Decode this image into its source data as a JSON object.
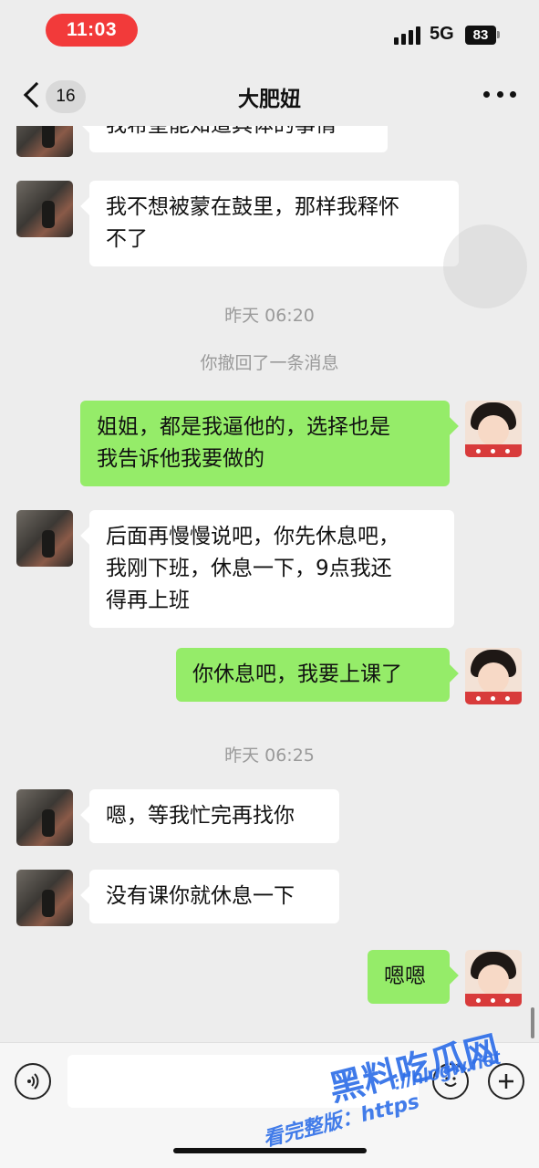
{
  "status_bar": {
    "time": "11:03",
    "network": "5G",
    "battery": "83"
  },
  "header": {
    "back_badge": "16",
    "title": "大肥妞"
  },
  "messages": [
    {
      "side": "in",
      "text": "我希望能知道具体的事情"
    },
    {
      "side": "in",
      "text": "我不想被蒙在鼓里，那样我释怀\n不了"
    },
    {
      "side": "system",
      "text": "昨天 06:20"
    },
    {
      "side": "system",
      "text": "你撤回了一条消息"
    },
    {
      "side": "out",
      "text": "姐姐，都是我逼他的，选择也是\n我告诉他我要做的"
    },
    {
      "side": "in",
      "text": "后面再慢慢说吧，你先休息吧，\n我刚下班，休息一下，9点我还\n得再上班"
    },
    {
      "side": "out",
      "text": "你休息吧，我要上课了"
    },
    {
      "side": "system",
      "text": "昨天 06:25"
    },
    {
      "side": "in",
      "text": "嗯，等我忙完再找你"
    },
    {
      "side": "in",
      "text": "没有课你就休息一下"
    },
    {
      "side": "out",
      "text": "嗯嗯"
    }
  ],
  "watermark": {
    "brand": "黑料吃瓜网",
    "url": "://hlcgw.net",
    "prefix": "看完整版：https"
  },
  "colors": {
    "outgoing_bubble": "#95ec69",
    "incoming_bubble": "#ffffff",
    "background": "#ededed",
    "time_pill": "#f23a3a",
    "watermark": "#2f6fe8"
  }
}
